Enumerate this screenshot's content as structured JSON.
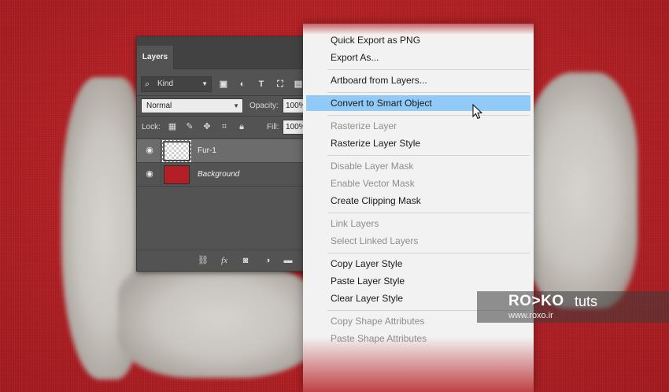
{
  "layers_panel": {
    "tab_label": "Layers",
    "filter": {
      "kind_label": "Kind",
      "icons": [
        "image-filter-icon",
        "adjustment-filter-icon",
        "type-filter-icon",
        "shape-filter-icon",
        "smart-object-filter-icon"
      ]
    },
    "blend_mode": "Normal",
    "opacity_label": "Opacity:",
    "opacity_value": "100%",
    "lock_label": "Lock:",
    "fill_label": "Fill:",
    "fill_value": "100%",
    "layers": [
      {
        "name": "Fur-1",
        "selected": true,
        "visible": true,
        "thumbnail": "transparent"
      },
      {
        "name": "Background",
        "selected": false,
        "visible": true,
        "thumbnail": "red",
        "italic": true
      }
    ],
    "bottom_icons": [
      "link-layers-icon",
      "fx-icon",
      "layer-mask-icon",
      "adjustment-layer-icon",
      "new-group-icon"
    ]
  },
  "context_menu": {
    "items": [
      {
        "label": "Quick Export as PNG",
        "disabled": false
      },
      {
        "label": "Export As...",
        "disabled": false
      },
      {
        "label": "Artboard from Layers...",
        "disabled": false
      },
      {
        "label": "Convert to Smart Object",
        "disabled": false,
        "hover": true
      },
      {
        "label": "Rasterize Layer",
        "disabled": true
      },
      {
        "label": "Rasterize Layer Style",
        "disabled": false
      },
      {
        "label": "Disable Layer Mask",
        "disabled": true
      },
      {
        "label": "Enable Vector Mask",
        "disabled": true
      },
      {
        "label": "Create Clipping Mask",
        "disabled": false
      },
      {
        "label": "Link Layers",
        "disabled": true
      },
      {
        "label": "Select Linked Layers",
        "disabled": true
      },
      {
        "label": "Copy Layer Style",
        "disabled": false
      },
      {
        "label": "Paste Layer Style",
        "disabled": false
      },
      {
        "label": "Clear Layer Style",
        "disabled": false
      },
      {
        "label": "Copy Shape Attributes",
        "disabled": true
      },
      {
        "label": "Paste Shape Attributes",
        "disabled": true
      }
    ]
  },
  "watermark": {
    "brand": "RO>KO",
    "tuts": "tuts",
    "url": "www.roxo.ir"
  },
  "colors": {
    "background_red": "#b52226",
    "menu_hover": "#91c9f7",
    "panel_gray": "#535353"
  }
}
